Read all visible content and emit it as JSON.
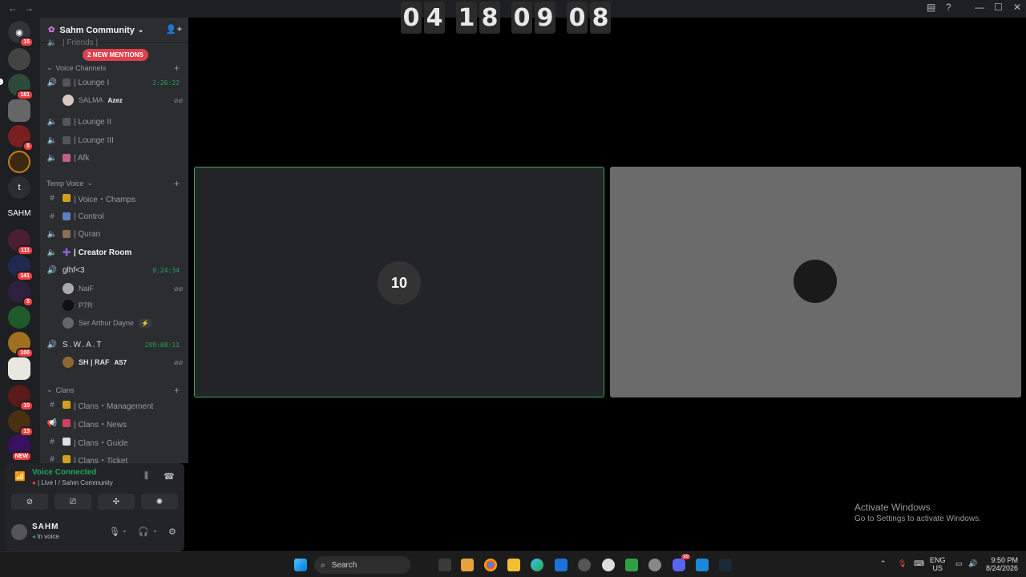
{
  "window": {
    "back_icon": "arrow-left",
    "forward_icon": "arrow-right"
  },
  "clock": {
    "digits": [
      "0",
      "4",
      "1",
      "8",
      "0",
      "9",
      "0",
      "8"
    ]
  },
  "servers": {
    "items": [
      {
        "badge": "15",
        "label": ""
      },
      {
        "badge": "",
        "label": ""
      },
      {
        "badge": "181",
        "label": ""
      },
      {
        "badge": "",
        "label": ""
      },
      {
        "badge": "5",
        "label": ""
      },
      {
        "badge": "",
        "label": ""
      },
      {
        "badge": "",
        "label": "t"
      },
      {
        "badge": "",
        "label": "SAHM"
      },
      {
        "badge": "111",
        "label": ""
      },
      {
        "badge": "141",
        "label": ""
      },
      {
        "badge": "5",
        "label": ""
      },
      {
        "badge": "",
        "label": ""
      },
      {
        "badge": "100",
        "label": ""
      },
      {
        "badge": "",
        "label": ""
      },
      {
        "badge": "10",
        "label": ""
      },
      {
        "badge": "13",
        "label": ""
      },
      {
        "badge": "NEW",
        "label": ""
      }
    ]
  },
  "guild": {
    "name": "Sahm Community",
    "mentions_label": "2 NEW MENTIONS",
    "partial_channel": "| Friends |"
  },
  "categories": {
    "voice": "Voice Channels",
    "temp": "Temp Voice",
    "clans": "Clans"
  },
  "voice_channels": [
    {
      "name": "| Lounge I",
      "time": "2:26:22"
    },
    {
      "name": "| Lounge II",
      "time": ""
    },
    {
      "name": "| Lounge III",
      "time": ""
    },
    {
      "name": "| Afk",
      "time": ""
    }
  ],
  "lounge1_members": [
    {
      "name": "SALMA",
      "tag": "Azez"
    }
  ],
  "temp_channels": [
    {
      "name": "| Voice・Champs"
    },
    {
      "name": "| Control"
    },
    {
      "name": "| Quran"
    },
    {
      "name": "| Creator Room"
    },
    {
      "name": "glhf<3",
      "time": "9:24:34"
    }
  ],
  "glhf_members": [
    {
      "name": "NaiF"
    },
    {
      "name": "P7R"
    },
    {
      "name": "Ser Arthur Dayne"
    }
  ],
  "swat": {
    "name": "S.W.A.T",
    "time": "209:08:11"
  },
  "swat_members": [
    {
      "name": "SH | RAF",
      "tag": "AS7"
    }
  ],
  "clan_channels": [
    {
      "name": "| Clans・Management"
    },
    {
      "name": "| Clans・News"
    },
    {
      "name": "| Clans・Guide"
    },
    {
      "name": "| Clans・Ticket"
    }
  ],
  "voice_panel": {
    "status": "Voice Connected",
    "location": "| Live I / Sahm Community"
  },
  "user": {
    "name": "SAHM",
    "state": "In voice"
  },
  "stage": {
    "tile1_avatar_text": "10"
  },
  "watermark": {
    "line1": "Activate Windows",
    "line2": "Go to Settings to activate Windows."
  },
  "taskbar": {
    "search_label": "Search",
    "lang": "ENG",
    "region": "US",
    "time": "9:50 PM",
    "date": "8/24/2026",
    "discord_badge": "99"
  },
  "colors": {
    "accent_green": "#23a559",
    "tile_border": "#3ba55d",
    "mention_red": "#e0404c"
  }
}
